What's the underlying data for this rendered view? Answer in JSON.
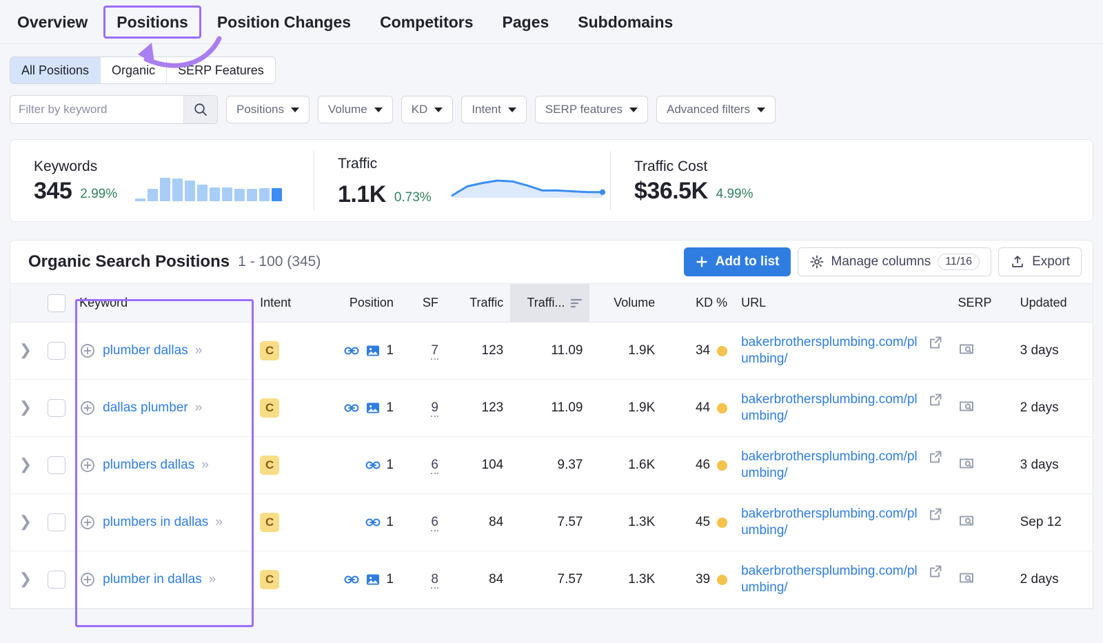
{
  "nav": {
    "items": [
      {
        "label": "Overview",
        "active": false
      },
      {
        "label": "Positions",
        "active": true
      },
      {
        "label": "Position Changes",
        "active": false
      },
      {
        "label": "Competitors",
        "active": false
      },
      {
        "label": "Pages",
        "active": false
      },
      {
        "label": "Subdomains",
        "active": false
      }
    ]
  },
  "segments": [
    {
      "label": "All Positions",
      "active": true
    },
    {
      "label": "Organic",
      "active": false
    },
    {
      "label": "SERP Features",
      "active": false
    }
  ],
  "filters": {
    "search_placeholder": "Filter by keyword",
    "search_value": "",
    "search_icon": "search-icon",
    "dropdowns": [
      {
        "label": "Positions"
      },
      {
        "label": "Volume"
      },
      {
        "label": "KD"
      },
      {
        "label": "Intent"
      },
      {
        "label": "SERP features"
      },
      {
        "label": "Advanced filters"
      }
    ]
  },
  "metrics": [
    {
      "title": "Keywords",
      "value": "345",
      "delta": "2.99%",
      "chart": "bars"
    },
    {
      "title": "Traffic",
      "value": "1.1K",
      "delta": "0.73%",
      "chart": "area"
    },
    {
      "title": "Traffic Cost",
      "value": "$36.5K",
      "delta": "4.99%",
      "chart": "none"
    }
  ],
  "chart_data": [
    {
      "type": "bar",
      "title": "Keywords",
      "categories": [
        "1",
        "2",
        "3",
        "4",
        "5",
        "6",
        "7",
        "8",
        "9",
        "10",
        "11",
        "12"
      ],
      "values": [
        3,
        13,
        25,
        24,
        22,
        18,
        15,
        15,
        13,
        13,
        14,
        14
      ],
      "ylabel": "",
      "xlabel": "",
      "grid": false,
      "legend": "none",
      "colors": {
        "bar": "#a8cdf7",
        "bar_last": "#3b8df3"
      }
    },
    {
      "type": "area",
      "title": "Traffic",
      "x": [
        0,
        1,
        2,
        3,
        4,
        5,
        6,
        7,
        8,
        9,
        10
      ],
      "values": [
        2,
        13,
        17,
        20,
        19,
        14,
        8,
        8,
        7,
        6,
        6
      ],
      "ylabel": "",
      "xlabel": "",
      "grid": false,
      "legend": "none",
      "colors": {
        "line": "#3b8df3",
        "fill": "#ddeafc",
        "marker": "#3b8df3"
      }
    }
  ],
  "panel": {
    "title": "Organic Search Positions",
    "count": "1 - 100 (345)",
    "add_to_list": "Add to list",
    "manage_columns": "Manage columns",
    "manage_columns_count": "11/16",
    "export": "Export"
  },
  "table": {
    "headers": {
      "keyword": "Keyword",
      "intent": "Intent",
      "position": "Position",
      "sf": "SF",
      "traffic": "Traffic",
      "traffic_pct": "Traffi...",
      "volume": "Volume",
      "kd": "KD %",
      "url": "URL",
      "serp": "SERP",
      "updated": "Updated"
    },
    "sorted_column": "traffic_pct",
    "rows": [
      {
        "keyword": "plumber dallas",
        "intent": "C",
        "pos_icons": [
          "link-icon",
          "image-icon"
        ],
        "position": "1",
        "sf": "7",
        "traffic": "123",
        "traffic_pct": "11.09",
        "volume": "1.9K",
        "kd": "34",
        "url": "bakerbrothersplumbing.com/plumbing/",
        "updated": "3 days"
      },
      {
        "keyword": "dallas plumber",
        "intent": "C",
        "pos_icons": [
          "link-icon",
          "image-icon"
        ],
        "position": "1",
        "sf": "9",
        "traffic": "123",
        "traffic_pct": "11.09",
        "volume": "1.9K",
        "kd": "44",
        "url": "bakerbrothersplumbing.com/plumbing/",
        "updated": "2 days"
      },
      {
        "keyword": "plumbers dallas",
        "intent": "C",
        "pos_icons": [
          "link-icon"
        ],
        "position": "1",
        "sf": "6",
        "traffic": "104",
        "traffic_pct": "9.37",
        "volume": "1.6K",
        "kd": "46",
        "url": "bakerbrothersplumbing.com/plumbing/",
        "updated": "3 days"
      },
      {
        "keyword": "plumbers in dallas",
        "intent": "C",
        "pos_icons": [
          "link-icon"
        ],
        "position": "1",
        "sf": "6",
        "traffic": "84",
        "traffic_pct": "7.57",
        "volume": "1.3K",
        "kd": "45",
        "url": "bakerbrothersplumbing.com/plumbing/",
        "updated": "Sep 12"
      },
      {
        "keyword": "plumber in dallas",
        "intent": "C",
        "pos_icons": [
          "link-icon",
          "image-icon"
        ],
        "position": "1",
        "sf": "8",
        "traffic": "84",
        "traffic_pct": "7.57",
        "volume": "1.3K",
        "kd": "39",
        "url": "bakerbrothersplumbing.com/plumbing/",
        "updated": "2 days"
      }
    ]
  },
  "annotations": {
    "highlight_color": "#9b6dff",
    "boxes": [
      "positions-tab",
      "keyword-column"
    ],
    "arrow": "curved-arrow-pointing-to-positions-tab"
  }
}
